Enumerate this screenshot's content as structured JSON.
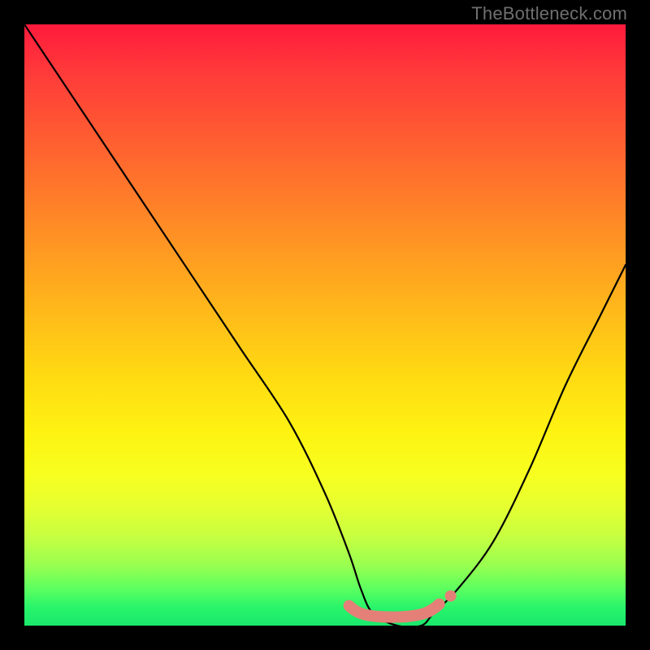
{
  "watermark": {
    "text": "TheBottleneck.com"
  },
  "chart_data": {
    "type": "line",
    "title": "",
    "xlabel": "",
    "ylabel": "",
    "xlim": [
      0,
      100
    ],
    "ylim": [
      0,
      100
    ],
    "series": [
      {
        "name": "bottleneck-curve",
        "x": [
          0,
          8,
          12,
          20,
          28,
          36,
          44,
          50,
          54,
          56,
          58,
          62,
          66,
          68,
          72,
          78,
          84,
          90,
          96,
          100
        ],
        "values": [
          100,
          88,
          82,
          70,
          58,
          46,
          34,
          22,
          12,
          6,
          2,
          0,
          0,
          2,
          6,
          14,
          26,
          40,
          52,
          60
        ]
      }
    ],
    "markers": [
      {
        "name": "valley-band",
        "x_range_pct": [
          54,
          69
        ],
        "y_pct": 2.5,
        "color": "#e58078"
      }
    ],
    "background_gradient": {
      "direction": "vertical",
      "stops": [
        {
          "pct": 0,
          "color": "#ff1a3c"
        },
        {
          "pct": 50,
          "color": "#ffd912"
        },
        {
          "pct": 75,
          "color": "#f7ff20"
        },
        {
          "pct": 100,
          "color": "#1ae86c"
        }
      ]
    }
  }
}
